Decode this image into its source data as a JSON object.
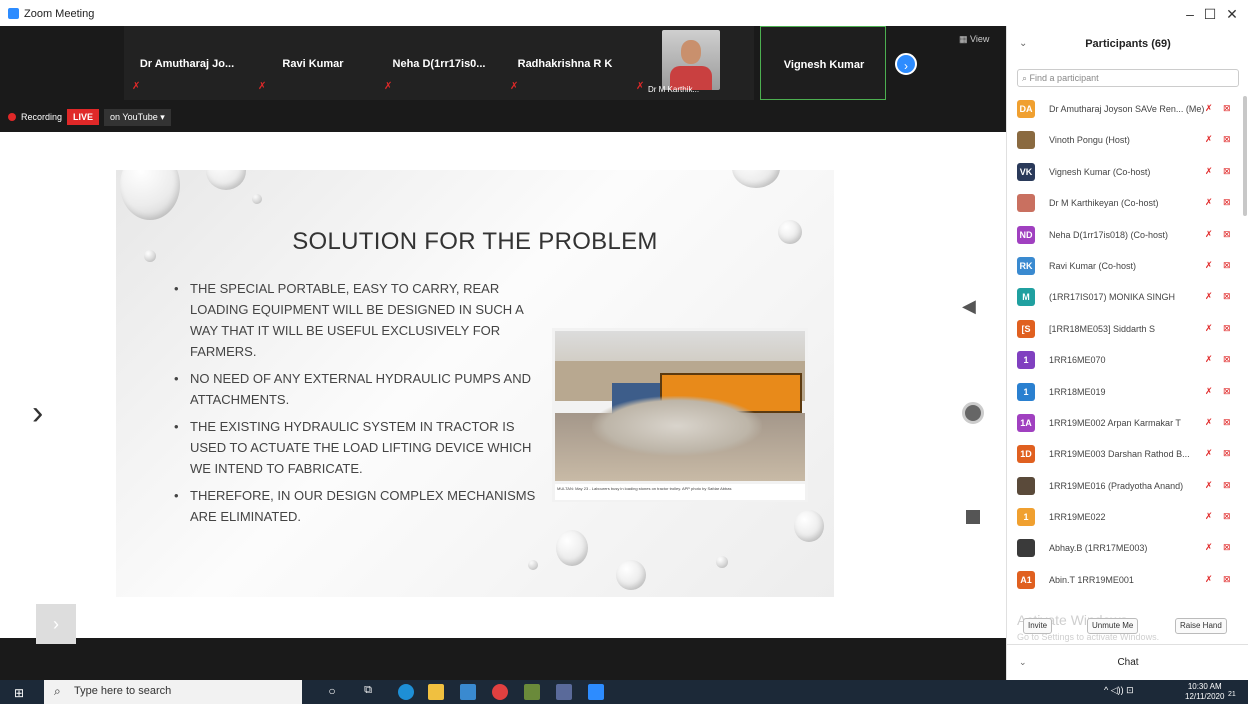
{
  "window": {
    "title": "Zoom Meeting",
    "minimize": "–",
    "maximize": "☐",
    "close": "✕"
  },
  "thumbnails": [
    {
      "name": "Dr Amutharaj Jo..."
    },
    {
      "name": "Ravi Kumar"
    },
    {
      "name": "Neha D(1rr17is0..."
    },
    {
      "name": "Radhakrishna R K"
    },
    {
      "name": "Dr M Karthik..."
    },
    {
      "name": "Vignesh Kumar"
    }
  ],
  "view_label": "View",
  "recording": {
    "label": "Recording",
    "live": "LIVE",
    "destination": "on YouTube ▾"
  },
  "slide": {
    "title": "SOLUTION FOR THE PROBLEM",
    "bullets": [
      "THE SPECIAL PORTABLE, EASY TO CARRY, REAR LOADING EQUIPMENT WILL BE DESIGNED IN SUCH A WAY THAT IT WILL BE USEFUL EXCLUSIVELY FOR FARMERS.",
      "NO NEED OF ANY EXTERNAL HYDRAULIC PUMPS AND ATTACHMENTS.",
      "THE EXISTING HYDRAULIC SYSTEM IN TRACTOR IS USED TO ACTUATE THE LOAD LIFTING DEVICE WHICH WE INTEND TO FABRICATE.",
      "THEREFORE, IN OUR DESIGN COMPLEX MECHANISMS ARE ELIMINATED."
    ],
    "photo_caption": "MULTAN: May 23 - Labourers busy in loading stones on tractor trolley. APP photo by Safdar Abbas"
  },
  "participants": {
    "title": "Participants (69)",
    "search_placeholder": "Find a participant",
    "list": [
      {
        "initials": "DA",
        "color": "#f0a030",
        "name": "Dr Amutharaj Joyson SAVe Ren... (Me)"
      },
      {
        "initials": "",
        "color": "#8a6a40",
        "name": "Vinoth Pongu (Host)"
      },
      {
        "initials": "VK",
        "color": "#2a3a5a",
        "name": "Vignesh Kumar (Co-host)"
      },
      {
        "initials": "",
        "color": "#c97060",
        "name": "Dr M Karthikeyan (Co-host)"
      },
      {
        "initials": "ND",
        "color": "#a040c0",
        "name": "Neha D(1rr17is018) (Co-host)"
      },
      {
        "initials": "RK",
        "color": "#3a8ad0",
        "name": "Ravi Kumar (Co-host)"
      },
      {
        "initials": "M",
        "color": "#20a0a0",
        "name": "(1RR17IS017) MONIKA SINGH"
      },
      {
        "initials": "[S",
        "color": "#e06020",
        "name": "[1RR18ME053] Siddarth S"
      },
      {
        "initials": "1",
        "color": "#8040c0",
        "name": "1RR16ME070"
      },
      {
        "initials": "1",
        "color": "#2a80d0",
        "name": "1RR18ME019"
      },
      {
        "initials": "1A",
        "color": "#a040c0",
        "name": "1RR19ME002 Arpan Karmakar T"
      },
      {
        "initials": "1D",
        "color": "#e06020",
        "name": "1RR19ME003 Darshan Rathod B..."
      },
      {
        "initials": "",
        "color": "#5a4a3a",
        "name": "1RR19ME016 (Pradyotha Anand)"
      },
      {
        "initials": "1",
        "color": "#f0a030",
        "name": "1RR19ME022"
      },
      {
        "initials": "",
        "color": "#3a3a3a",
        "name": "Abhay.B (1RR17ME003)"
      },
      {
        "initials": "A1",
        "color": "#e06020",
        "name": "Abin.T 1RR19ME001"
      }
    ],
    "watermark_line1": "Activate Windows",
    "watermark_line2": "Go to Settings to activate Windows.",
    "invite": "Invite",
    "unmute_me": "Unmute Me",
    "raise_hand": "Raise Hand"
  },
  "chat": {
    "title": "Chat"
  },
  "taskbar": {
    "search_placeholder": "Type here to search",
    "time": "10:30 AM",
    "date": "12/11/2020",
    "tray": "^ ◁)) ⊡",
    "notif_count": "21"
  }
}
